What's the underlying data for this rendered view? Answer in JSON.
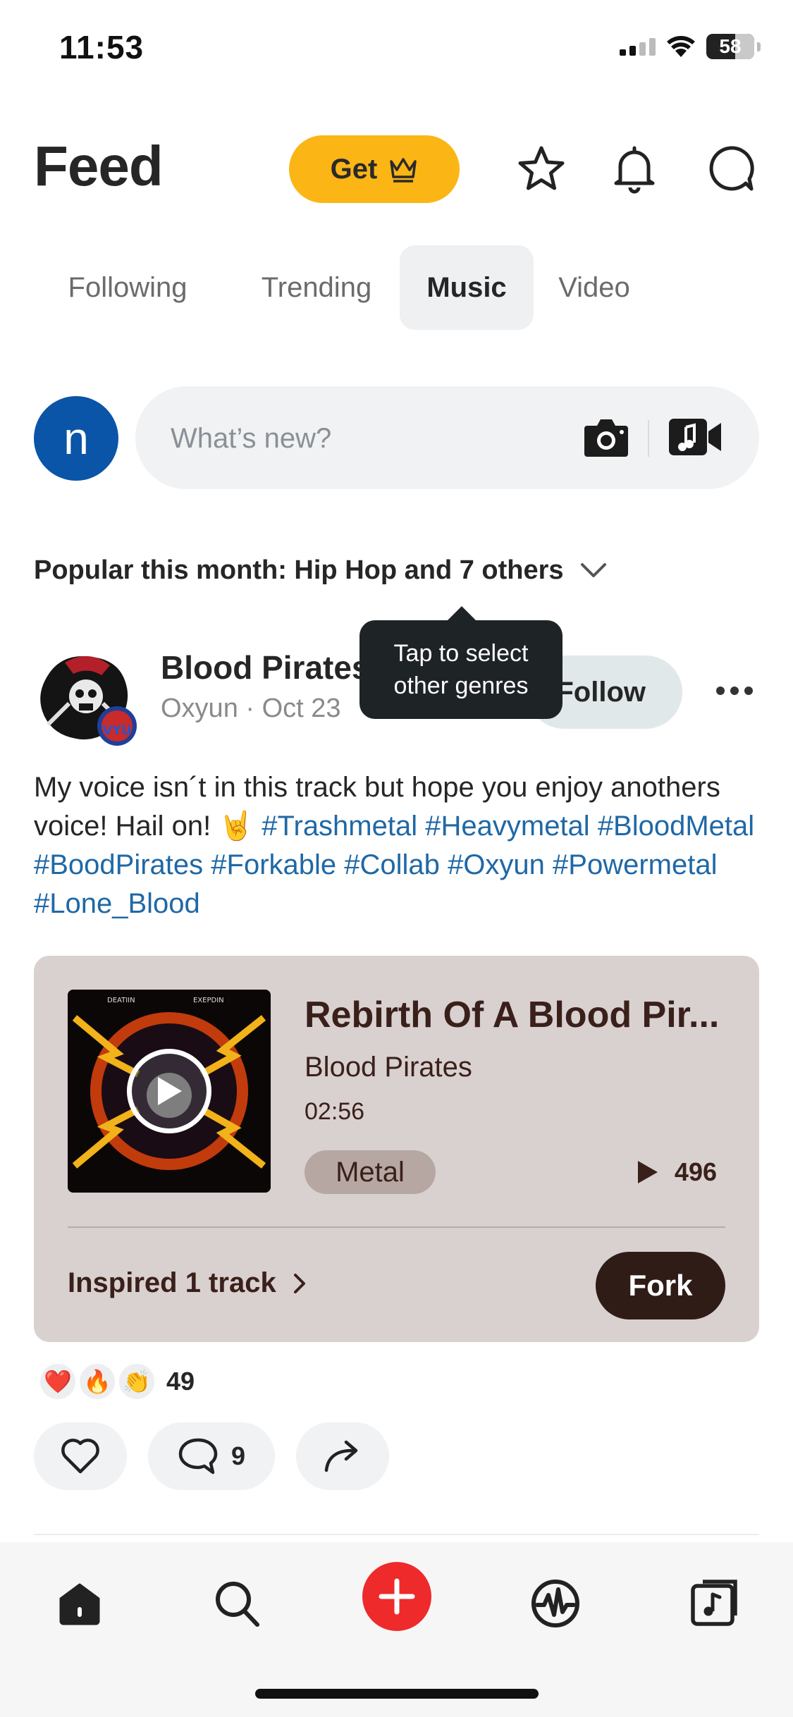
{
  "status_bar": {
    "time": "11:53",
    "battery": "58"
  },
  "header": {
    "title": "Feed",
    "get_label": "Get"
  },
  "tabs": [
    {
      "label": "Following",
      "active": false
    },
    {
      "label": "Trending",
      "active": false
    },
    {
      "label": "Music",
      "active": true
    },
    {
      "label": "Video",
      "active": false
    }
  ],
  "composer": {
    "avatar_initial": "n",
    "placeholder": "What’s new?"
  },
  "genre_filter": {
    "label": "Popular this month: Hip Hop and 7 others"
  },
  "tooltip": {
    "line1": "Tap to select",
    "line2": "other genres"
  },
  "post": {
    "title": "Blood Pirates",
    "author": "Oxyun",
    "date": "Oct 23",
    "follow_label": "Follow",
    "text_before_emoji": "My voice isn´t in this track but hope you enjoy anothers voice! Hail on!",
    "emoji": "🤘",
    "hashtags": [
      "#Trashmetal",
      "#Heavymetal",
      "#BloodMetal",
      "#BoodPirates",
      "#Forkable",
      "#Collab",
      "#Oxyun",
      "#Powermetal",
      "#Lone_Blood"
    ]
  },
  "track": {
    "title": "Rebirth Of A Blood Pir...",
    "artist": "Blood Pirates",
    "duration": "02:56",
    "genre": "Metal",
    "plays": "496",
    "cover_text_left": "DEATIIN",
    "cover_text_right": "EXEPDIN",
    "inspired_label": "Inspired 1 track",
    "fork_label": "Fork"
  },
  "reactions": {
    "emojis": [
      "❤️",
      "🔥",
      "👏"
    ],
    "count": "49"
  },
  "actions": {
    "comments": "9"
  },
  "colors": {
    "accent_yellow": "#fbb515",
    "create_red": "#ee2a2a",
    "hashtag_blue": "#1f68a6",
    "card_bg": "#d9d1cf",
    "fork_bg": "#301c17"
  }
}
